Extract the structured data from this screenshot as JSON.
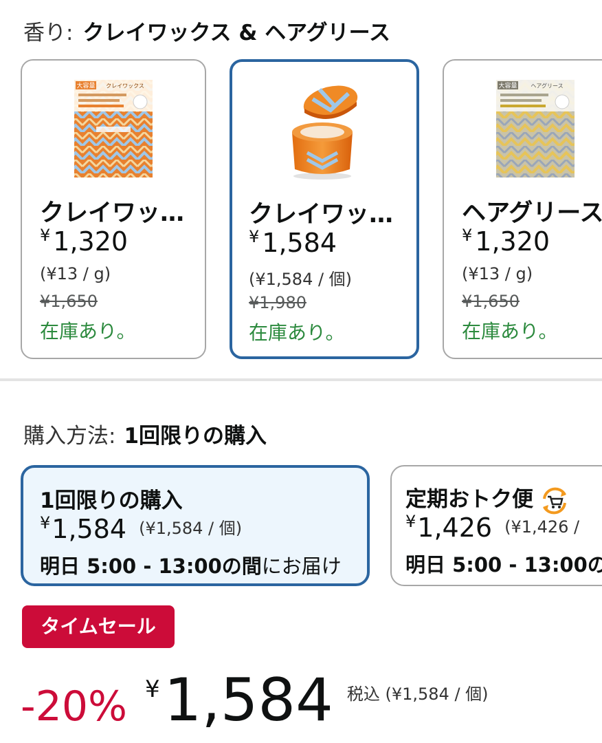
{
  "scent": {
    "label": "香り:",
    "selected": "クレイワックス & ヘアグリース"
  },
  "variants": [
    {
      "name": "クレイワッ…",
      "price": "1,320",
      "unit_price": "(¥13 / g)",
      "list_price": "¥1,650",
      "stock": "在庫あり。",
      "image_text": [
        "大容量",
        "クレイワックス"
      ]
    },
    {
      "name": "クレイワッ…",
      "price": "1,584",
      "unit_price": "(¥1,584 / 個)",
      "list_price": "¥1,980",
      "stock": "在庫あり。"
    },
    {
      "name": "ヘアグリース",
      "price": "1,320",
      "unit_price": "(¥13 / g)",
      "list_price": "¥1,650",
      "stock": "在庫あり。",
      "image_text": [
        "大容量",
        "ヘアグリース"
      ]
    }
  ],
  "currency_symbol": "¥",
  "purchase_method": {
    "label": "購入方法:",
    "selected": "1回限りの購入",
    "options": [
      {
        "title": "1回限りの購入",
        "price": "1,584",
        "unit_price": "(¥1,584 / 個)",
        "delivery_bold": "明日 5:00 - 13:00の間",
        "delivery_rest": "にお届け"
      },
      {
        "title": "定期おトク便",
        "price": "1,426",
        "unit_price": "(¥1,426 /",
        "delivery_bold": "明日 5:00 - 13:00の",
        "delivery_rest": "",
        "icon": "subscribe-cart-icon"
      }
    ]
  },
  "deal": {
    "badge": "タイムセール",
    "discount": "-20%",
    "price": "1,584",
    "tax_note": "税込 (¥1,584 / 個)"
  },
  "colors": {
    "selected_border": "#2b65a0",
    "in_stock": "#2c8a3e",
    "deal_red": "#cc0c39",
    "selected_bg": "#edf6fd"
  }
}
